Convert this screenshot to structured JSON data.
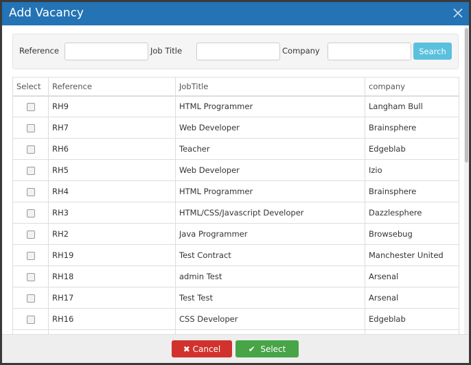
{
  "modal": {
    "title": "Add Vacancy",
    "close_icon": "close-icon"
  },
  "filter": {
    "reference_label": "Reference",
    "reference_value": "",
    "jobtitle_label": "Job Title",
    "jobtitle_value": "",
    "company_label": "Company",
    "company_value": "",
    "search_label": "Search"
  },
  "table": {
    "headers": [
      "Select",
      "Reference",
      "JobTitle",
      "company"
    ],
    "rows": [
      [
        "RH9",
        "HTML Programmer",
        "Langham Bull"
      ],
      [
        "RH7",
        "Web Developer",
        "Brainsphere"
      ],
      [
        "RH6",
        "Teacher",
        "Edgeblab"
      ],
      [
        "RH5",
        "Web Developer",
        "Izio"
      ],
      [
        "RH4",
        "HTML Programmer",
        "Brainsphere"
      ],
      [
        "RH3",
        "HTML/CSS/Javascript Developer",
        "Dazzlesphere"
      ],
      [
        "RH2",
        "Java Programmer",
        "Browsebug"
      ],
      [
        "RH19",
        "Test Contract",
        "Manchester United"
      ],
      [
        "RH18",
        "admin Test",
        "Arsenal"
      ],
      [
        "RH17",
        "Test Test",
        "Arsenal"
      ],
      [
        "RH16",
        "CSS Developer",
        "Edgeblab"
      ],
      [
        "",
        "",
        ""
      ]
    ]
  },
  "footer": {
    "cancel_label": "Cancel",
    "select_label": "Select"
  },
  "colors": {
    "header": "#2373b5",
    "search": "#5bc0de",
    "cancel": "#d2322d",
    "select": "#47a447"
  }
}
